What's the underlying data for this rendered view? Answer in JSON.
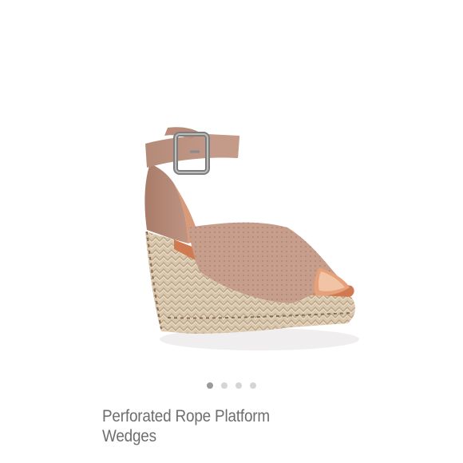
{
  "product": {
    "title": "Perforated Rope Platform Wedges",
    "image_alt": "Blush perforated peep-toe wedge sandal with ankle strap and espadrille rope platform"
  },
  "carousel": {
    "total_slides": 4,
    "active_index": 0
  },
  "colors": {
    "leather": "#c49a88",
    "rope": "#d9c7ad",
    "dot_active": "#9a9a9a",
    "dot_inactive": "#d5d5d5",
    "title": "#6e6e6e"
  }
}
